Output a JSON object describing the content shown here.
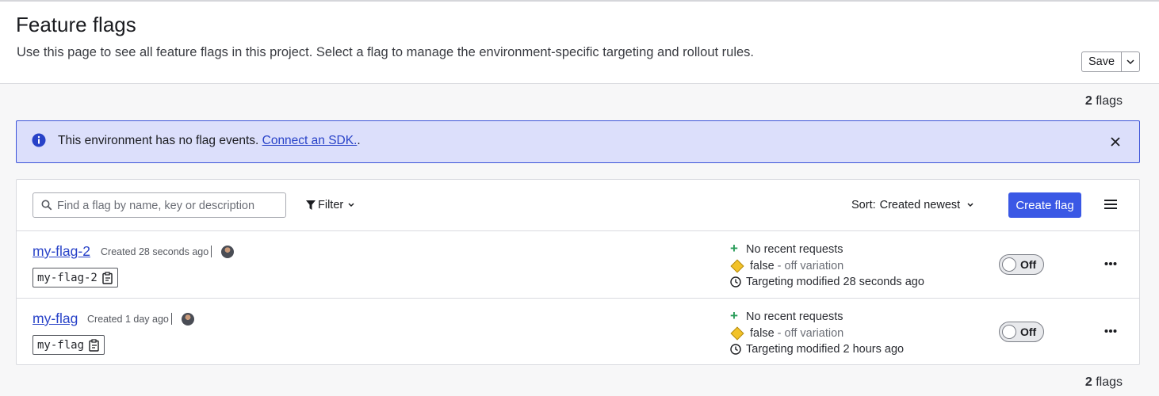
{
  "header": {
    "title": "Feature flags",
    "description": "Use this page to see all feature flags in this project. Select a flag to manage the environment-specific targeting and rollout rules.",
    "save_label": "Save"
  },
  "counts": {
    "top_number": "2",
    "top_unit": "flags",
    "bottom_number": "2",
    "bottom_unit": "flags"
  },
  "banner": {
    "text": "This environment has no flag events.",
    "link": "Connect an SDK.",
    "trailing": ".",
    "icon": "info-icon",
    "accent": "#3d54d9"
  },
  "toolbar": {
    "search_placeholder": "Find a flag by name, key or description",
    "search_value": "",
    "filter_label": "Filter",
    "sort_label": "Sort:",
    "sort_value": "Created newest",
    "create_label": "Create flag"
  },
  "flags": [
    {
      "name": "my-flag-2",
      "created": "Created 28 seconds ago",
      "key": "my-flag-2",
      "requests": "No recent requests",
      "variation_value": "false",
      "variation_note": "- off variation",
      "targeting": "Targeting modified 28 seconds ago",
      "toggle": "Off"
    },
    {
      "name": "my-flag",
      "created": "Created 1 day ago",
      "key": "my-flag",
      "requests": "No recent requests",
      "variation_value": "false",
      "variation_note": "- off variation",
      "targeting": "Targeting modified 2 hours ago",
      "toggle": "Off"
    }
  ],
  "colors": {
    "primary": "#3a58e5",
    "link": "#2842c8",
    "success": "#2a9d5a",
    "variation_off": "#f2c228"
  }
}
